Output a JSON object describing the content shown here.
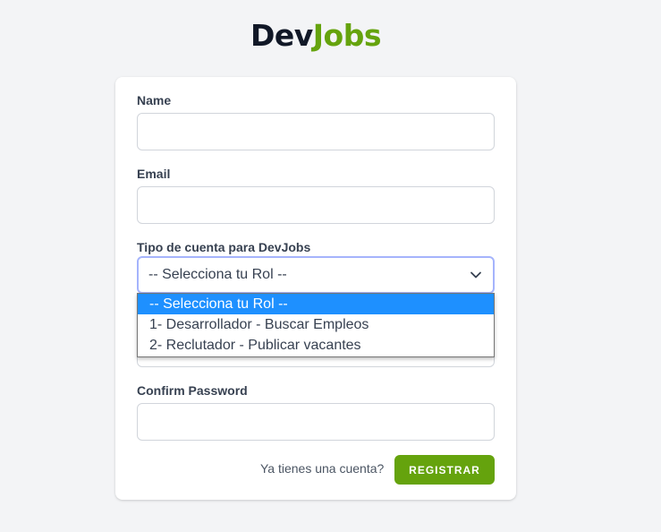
{
  "logo": {
    "part1": "Dev",
    "part2": "Jobs"
  },
  "form": {
    "name_label": "Name",
    "email_label": "Email",
    "role_label": "Tipo de cuenta para DevJobs",
    "role_selected": "-- Selecciona tu Rol --",
    "role_options": [
      "-- Selecciona tu Rol --",
      "1- Desarrollador - Buscar Empleos",
      "2- Reclutador - Publicar vacantes"
    ],
    "confirm_password_label": "Confirm Password",
    "login_link": "Ya tienes una cuenta?",
    "submit_label": "REGISTRAR"
  },
  "colors": {
    "brand_dark": "#111827",
    "brand_green": "#65a30d",
    "option_highlight": "#1e90ff",
    "focus_ring": "#a5b4fc"
  },
  "icons": {
    "select_arrow": "chevron-down-icon"
  }
}
